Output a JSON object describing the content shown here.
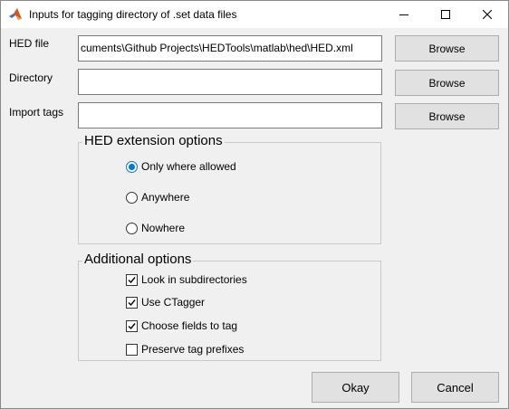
{
  "window": {
    "title": "Inputs for tagging directory of .set data files",
    "app_icon": "matlab-icon",
    "controls": [
      "minimize-icon",
      "maximize-icon",
      "close-icon"
    ]
  },
  "fields": {
    "hed_file": {
      "label": "HED file",
      "value": "C:\\Users\\...\\Documents\\Github Projects\\HEDTools\\matlab\\hed\\HED.xml",
      "visible_value": "cuments\\Github Projects\\HEDTools\\matlab\\hed\\HED.xml",
      "browse_label": "Browse"
    },
    "directory": {
      "label": "Directory",
      "value": "",
      "browse_label": "Browse"
    },
    "import_tags": {
      "label": "Import tags",
      "value": "",
      "browse_label": "Browse"
    }
  },
  "hed_extension": {
    "title": "HED extension options",
    "options": [
      {
        "label": "Only where allowed",
        "selected": true
      },
      {
        "label": "Anywhere",
        "selected": false
      },
      {
        "label": "Nowhere",
        "selected": false
      }
    ]
  },
  "additional": {
    "title": "Additional options",
    "options": [
      {
        "label": "Look in subdirectories",
        "checked": true
      },
      {
        "label": "Use CTagger",
        "checked": true
      },
      {
        "label": "Choose fields to tag",
        "checked": true
      },
      {
        "label": "Preserve tag prefixes",
        "checked": false
      }
    ]
  },
  "buttons": {
    "okay": "Okay",
    "cancel": "Cancel"
  },
  "colors": {
    "accent": "#0078d7",
    "background": "#f0f0f0",
    "button": "#e1e1e1"
  }
}
